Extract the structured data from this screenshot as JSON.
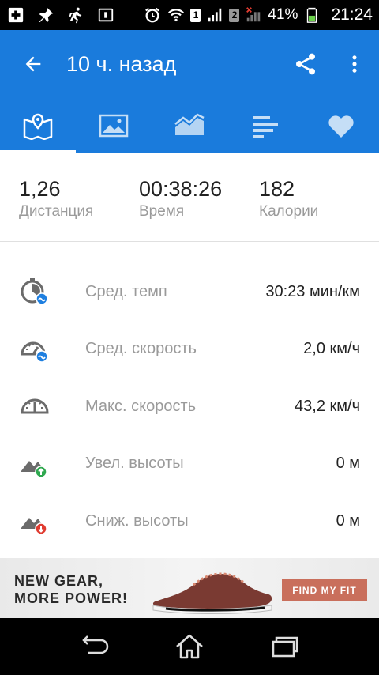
{
  "status_bar": {
    "battery": "41%",
    "time": "21:24",
    "sim1": "1",
    "sim2": "2"
  },
  "toolbar": {
    "title": "10 ч. назад"
  },
  "tabs": [
    {
      "icon": "map-icon",
      "active": true
    },
    {
      "icon": "photo-icon",
      "active": false
    },
    {
      "icon": "chart-icon",
      "active": false
    },
    {
      "icon": "splits-icon",
      "active": false
    },
    {
      "icon": "heart-icon",
      "active": false
    }
  ],
  "summary": {
    "distance": {
      "value": "1,26",
      "label": "Дистанция"
    },
    "time": {
      "value": "00:38:26",
      "label": "Время"
    },
    "calories": {
      "value": "182",
      "label": "Калории"
    }
  },
  "stats": [
    {
      "icon": "avg-pace-icon",
      "label": "Сред. темп",
      "value": "30:23 мин/км"
    },
    {
      "icon": "avg-speed-icon",
      "label": "Сред. скорость",
      "value": "2,0 км/ч"
    },
    {
      "icon": "max-speed-icon",
      "label": "Макс. скорость",
      "value": "43,2 км/ч"
    },
    {
      "icon": "elevation-gain-icon",
      "label": "Увел. высоты",
      "value": "0 м"
    },
    {
      "icon": "elevation-loss-icon",
      "label": "Сниж. высоты",
      "value": "0 м"
    }
  ],
  "ad": {
    "line1": "NEW GEAR,",
    "line2": "MORE POWER!",
    "cta": "FIND MY FIT"
  },
  "colors": {
    "primary": "#1a7bdc",
    "badge_blue": "#1e7fe0",
    "badge_green": "#2fa84f",
    "badge_red": "#e03c31"
  }
}
